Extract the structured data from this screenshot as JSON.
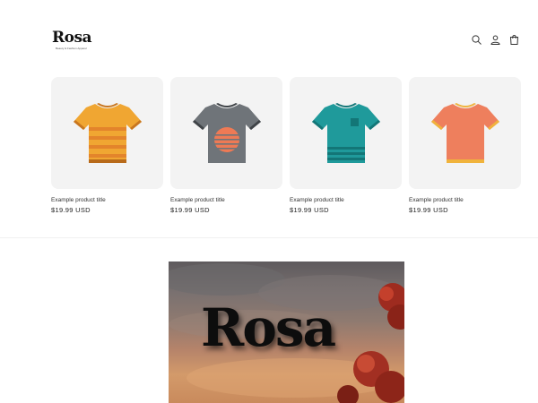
{
  "header": {
    "logo_text": "Rosa",
    "logo_tagline": "Beauty & Fashion Apparel",
    "icons": [
      "search-icon",
      "account-icon",
      "cart-icon"
    ]
  },
  "products": [
    {
      "title": "Example product title",
      "price": "$19.99 USD",
      "shirt_color": "#f0a632",
      "variant": "stripes"
    },
    {
      "title": "Example product title",
      "price": "$19.99 USD",
      "shirt_color": "#6f7479",
      "variant": "circle"
    },
    {
      "title": "Example product title",
      "price": "$19.99 USD",
      "shirt_color": "#1f9a9b",
      "variant": "pocket"
    },
    {
      "title": "Example product title",
      "price": "$19.99 USD",
      "shirt_color": "#ee7f5d",
      "variant": "plain"
    }
  ],
  "banner": {
    "text": "Rosa"
  }
}
